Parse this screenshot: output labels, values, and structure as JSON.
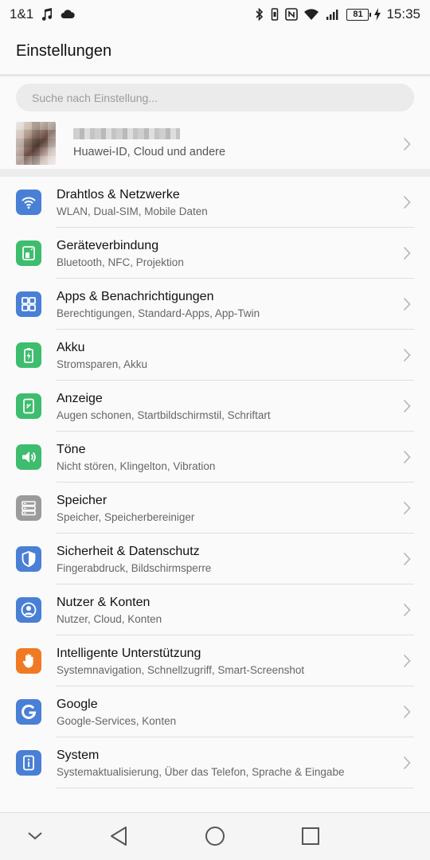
{
  "status": {
    "carrier": "1&1",
    "battery": "81",
    "time": "15:35",
    "icons": [
      "music-note-icon",
      "cloud-icon",
      "bluetooth-icon",
      "vibrate-icon",
      "nfc-icon",
      "wifi-icon",
      "signal-icon",
      "battery-icon",
      "charging-icon"
    ]
  },
  "header": {
    "title": "Einstellungen"
  },
  "search": {
    "placeholder": "Suche nach Einstellung..."
  },
  "account": {
    "subtitle": "Huawei-ID, Cloud und andere"
  },
  "items": [
    {
      "title": "Drahtlos & Netzwerke",
      "subtitle": "WLAN, Dual-SIM, Mobile Daten",
      "icon": "wifi-icon",
      "color": "#4a7fd6"
    },
    {
      "title": "Geräteverbindung",
      "subtitle": "Bluetooth, NFC, Projektion",
      "icon": "device-connection-icon",
      "color": "#3dbd6d"
    },
    {
      "title": "Apps & Benachrichtigungen",
      "subtitle": "Berechtigungen, Standard-Apps, App-Twin",
      "icon": "apps-grid-icon",
      "color": "#4a7fd6"
    },
    {
      "title": "Akku",
      "subtitle": "Stromsparen, Akku",
      "icon": "battery-icon",
      "color": "#3dbd6d"
    },
    {
      "title": "Anzeige",
      "subtitle": "Augen schonen, Startbildschirmstil, Schriftart",
      "icon": "display-icon",
      "color": "#3dbd6d"
    },
    {
      "title": "Töne",
      "subtitle": "Nicht stören, Klingelton, Vibration",
      "icon": "speaker-icon",
      "color": "#3dbd6d"
    },
    {
      "title": "Speicher",
      "subtitle": "Speicher, Speicherbereiniger",
      "icon": "storage-icon",
      "color": "#9b9b9b"
    },
    {
      "title": "Sicherheit & Datenschutz",
      "subtitle": "Fingerabdruck, Bildschirmsperre",
      "icon": "shield-icon",
      "color": "#4a7fd6"
    },
    {
      "title": "Nutzer & Konten",
      "subtitle": "Nutzer, Cloud, Konten",
      "icon": "user-icon",
      "color": "#4a7fd6"
    },
    {
      "title": "Intelligente Unterstützung",
      "subtitle": "Systemnavigation, Schnellzugriff, Smart-Screenshot",
      "icon": "hand-icon",
      "color": "#f07a24"
    },
    {
      "title": "Google",
      "subtitle": "Google-Services, Konten",
      "icon": "google-icon",
      "color": "#4a7fd6"
    },
    {
      "title": "System",
      "subtitle": "Systemaktualisierung, Über das Telefon, Sprache & Eingabe",
      "icon": "info-icon",
      "color": "#4a7fd6"
    }
  ]
}
